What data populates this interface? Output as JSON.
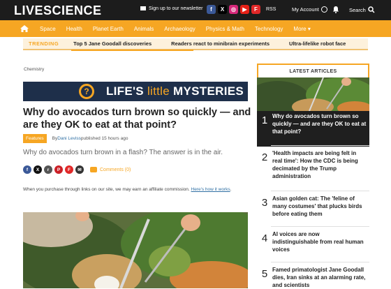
{
  "header": {
    "logo_live": "LIVE",
    "logo_science": "SCIENCE",
    "newsletter": "Sign up to our newsletter",
    "rss": "RSS",
    "my_account": "My Account",
    "search": "Search"
  },
  "socials": [
    {
      "icon": "facebook-icon",
      "glyph": "f",
      "color": "#3b5998"
    },
    {
      "icon": "x-icon",
      "glyph": "X",
      "color": "#000000"
    },
    {
      "icon": "instagram-icon",
      "glyph": "◎",
      "color": "#d6287a"
    },
    {
      "icon": "youtube-icon",
      "glyph": "▶",
      "color": "#e62117"
    },
    {
      "icon": "flipboard-icon",
      "glyph": "F",
      "color": "#e12828"
    }
  ],
  "nav": {
    "items": [
      "Space",
      "Health",
      "Planet Earth",
      "Animals",
      "Archaeology",
      "Physics & Math",
      "Technology",
      "More ▾"
    ]
  },
  "trending": {
    "label": "TRENDING",
    "items": [
      "Top 5 Jane Goodall discoveries",
      "Readers react to minibrain experiments",
      "Ultra-lifelike robot face"
    ]
  },
  "article": {
    "breadcrumb": "Chemistry",
    "banner_lifes": "LIFE'S ",
    "banner_little": "little",
    "banner_mysteries": " MYSTERIES",
    "headline": "Why do avocados turn brown so quickly — and are they OK to eat at that point?",
    "tag": "Features",
    "by": "By ",
    "author": "Dani Leviss",
    "published": " published 15 hours ago",
    "strap": "Why do avocados turn brown in a flash? The answer is in the air.",
    "comments": "Comments (0)",
    "affiliate_text": "When you purchase through links on our site, we may earn an affiliate commission. ",
    "affiliate_link": "Here's how it works",
    "affiliate_end": "."
  },
  "share_icons": [
    {
      "icon": "facebook-share-icon",
      "glyph": "f",
      "color": "#3b5998"
    },
    {
      "icon": "x-share-icon",
      "glyph": "X",
      "color": "#111111"
    },
    {
      "icon": "reddit-share-icon",
      "glyph": "r",
      "color": "#555555"
    },
    {
      "icon": "pinterest-share-icon",
      "glyph": "P",
      "color": "#cb2027"
    },
    {
      "icon": "flipboard-share-icon",
      "glyph": "F",
      "color": "#e12828"
    },
    {
      "icon": "email-share-icon",
      "glyph": "✉",
      "color": "#333333"
    }
  ],
  "sidebar": {
    "title": "LATEST ARTICLES",
    "items": [
      {
        "num": "1",
        "title": "Why do avocados turn brown so quickly — and are they OK to eat at that point?"
      },
      {
        "num": "2",
        "title": "'Health impacts are being felt in real time': How the CDC is being decimated by the Trump administration"
      },
      {
        "num": "3",
        "title": "Asian golden cat: The 'feline of many costumes' that plucks birds before eating them"
      },
      {
        "num": "4",
        "title": "AI voices are now indistinguishable from real human voices"
      },
      {
        "num": "5",
        "title": "Famed primatologist Jane Goodall dies, Iran sinks at an alarming rate, and scientists"
      }
    ]
  },
  "colors": {
    "accent": "#f6a623",
    "topbar": "#1c1c1c",
    "banner": "#1e2f4a",
    "link": "#2f6fa3"
  }
}
